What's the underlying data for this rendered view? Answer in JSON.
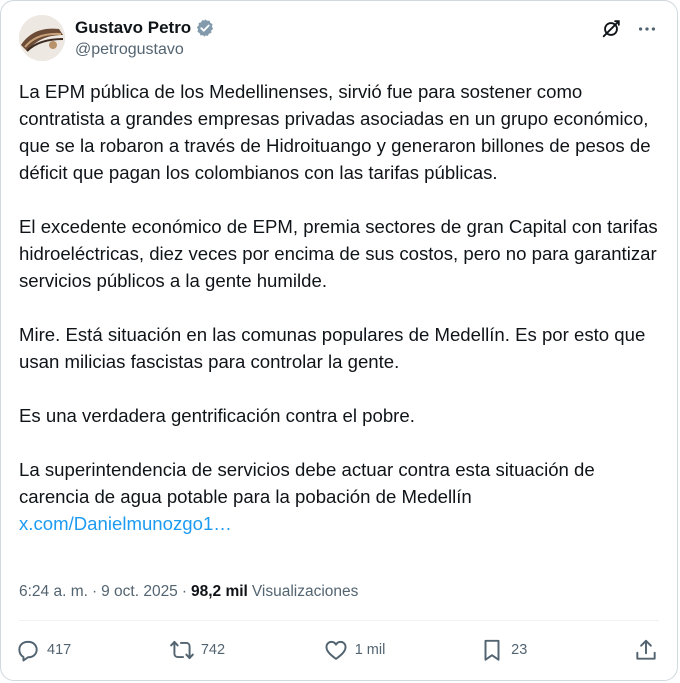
{
  "author": {
    "display_name": "Gustavo Petro",
    "handle": "@petrogustavo"
  },
  "tweet": {
    "paragraphs": [
      "La EPM pública de los Medellinenses, sirvió fue para sostener como contratista a grandes empresas privadas asociadas en un grupo económico, que se la robaron a través de Hidroituango y generaron billones de pesos de déficit que pagan los colombianos con las tarifas públicas.",
      "El excedente económico de EPM, premia sectores de gran Capital con tarifas hidroeléctricas, diez veces por encima de sus costos, pero no para  garantizar servicios públicos a la gente humilde.",
      "Mire. Está situación en las comunas populares de Medellín. Es por esto que usan milicias fascistas para controlar la gente.",
      "Es una verdadera gentrificación contra el pobre.",
      "La superintendencia de servicios debe actuar contra esta situación de carencia de agua potable para la pobación de Medellín"
    ],
    "link_text": "x.com/Danielmunozgo1…"
  },
  "meta": {
    "time": "6:24 a. m.",
    "separator": "·",
    "date": "9 oct. 2025",
    "views_count": "98,2 mil",
    "views_label": "Visualizaciones"
  },
  "actions": {
    "replies": "417",
    "reposts": "742",
    "likes": "1 mil",
    "bookmarks": "23"
  },
  "icons": {
    "verified": "verified-badge-icon",
    "grok": "grok-icon",
    "more": "more-icon",
    "reply": "reply-icon",
    "repost": "repost-icon",
    "like": "heart-icon",
    "bookmark": "bookmark-icon",
    "share": "share-icon"
  },
  "colors": {
    "text": "#0f1419",
    "secondary": "#536471",
    "link": "#1d9bf0",
    "verified_badge": "#829aab",
    "border": "#cfd9de"
  }
}
